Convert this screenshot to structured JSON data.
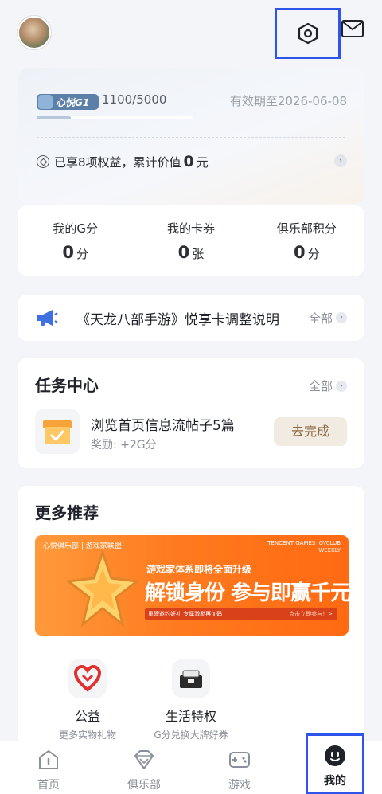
{
  "header": {
    "avatar_icon": "user-avatar",
    "settings_icon": "hexagon-settings-icon",
    "mail_icon": "envelope-icon"
  },
  "member_card": {
    "level_label": "心悦G1",
    "level_progress": "1100/5000",
    "level_progress_fraction": 0.22,
    "valid_until": "有效期至2026-06-08",
    "benefits_prefix": "已享8项权益，累计价值",
    "benefits_value": "0",
    "benefits_unit": "元"
  },
  "stats": [
    {
      "label": "我的G分",
      "value": "0",
      "unit": "分"
    },
    {
      "label": "我的卡券",
      "value": "0",
      "unit": "张"
    },
    {
      "label": "俱乐部积分",
      "value": "0",
      "unit": "分"
    }
  ],
  "notice": {
    "text": "《天龙八部手游》悦享卡调整说明",
    "all_label": "全部"
  },
  "tasks": {
    "title": "任务中心",
    "all_label": "全部",
    "items": [
      {
        "name": "浏览首页信息流帖子5篇",
        "reward": "奖励:  +2G分",
        "action": "去完成"
      }
    ]
  },
  "recommend": {
    "title": "更多推荐",
    "banner": {
      "logos": "心悦俱乐部  |  游戏家联盟",
      "english_line1": "TENCENT GAMES JOYCLUB",
      "english_line2": "WEEKLY",
      "subtitle": "游戏家体系即将全面升级",
      "headline": "解锁身份 参与即赢千元奖励",
      "strip": "重磅邀约好礼  专属激励再加码",
      "cta": "点击立即参与！>"
    },
    "items": [
      {
        "title": "公益",
        "subtitle": "更多实物礼物"
      },
      {
        "title": "生活特权",
        "subtitle": "G分兑换大牌好券"
      }
    ]
  },
  "tabbar": {
    "tabs": [
      {
        "label": "首页",
        "icon": "home-icon"
      },
      {
        "label": "俱乐部",
        "icon": "diamond-icon"
      },
      {
        "label": "游戏",
        "icon": "gamepad-icon"
      },
      {
        "label": "我的",
        "icon": "profile-face-icon"
      }
    ],
    "active": "我的"
  },
  "colors": {
    "accent_highlight": "#2f54eb",
    "banner_orange": "#ff7a1e",
    "task_button_bg": "#f2ebe1",
    "task_button_text": "#8a6a44"
  }
}
